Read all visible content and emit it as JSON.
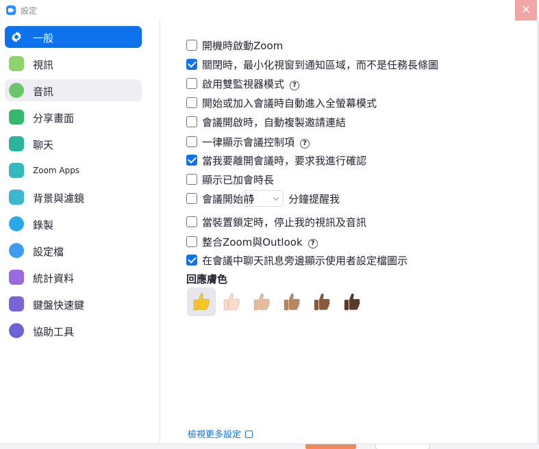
{
  "window": {
    "title": "設定",
    "close_symbol": "×"
  },
  "sidebar": {
    "items": [
      {
        "label": "一般",
        "icon": "gear-icon",
        "color": "#0e72ed",
        "state": "active"
      },
      {
        "label": "視訊",
        "icon": "video-camera-icon",
        "color": "#8fd36e"
      },
      {
        "label": "音訊",
        "icon": "headphones-icon",
        "color": "#6cc56a",
        "state": "hover"
      },
      {
        "label": "分享畫面",
        "icon": "share-screen-icon",
        "color": "#33b96c"
      },
      {
        "label": "聊天",
        "icon": "chat-bubble-icon",
        "color": "#2bb59a"
      },
      {
        "label": "Zoom Apps",
        "icon": "apps-icon",
        "color": "#35b9c0"
      },
      {
        "label": "背景與濾鏡",
        "icon": "background-icon",
        "color": "#3fb6cf"
      },
      {
        "label": "錄製",
        "icon": "record-icon",
        "color": "#29a9e8"
      },
      {
        "label": "設定檔",
        "icon": "profile-icon",
        "color": "#3f9bf0"
      },
      {
        "label": "統計資料",
        "icon": "statistics-icon",
        "color": "#9a6be0"
      },
      {
        "label": "鍵盤快速鍵",
        "icon": "keyboard-icon",
        "color": "#7a64d8"
      },
      {
        "label": "協助工具",
        "icon": "accessibility-icon",
        "color": "#6b62d6"
      }
    ]
  },
  "general": {
    "options": [
      {
        "label": "開機時啟動Zoom",
        "checked": false
      },
      {
        "label": "關閉時，最小化視窗到通知區域，而不是任務長條圖",
        "checked": true
      },
      {
        "label": "啟用雙監視器模式",
        "checked": false,
        "help": true
      },
      {
        "label": "開始或加入會議時自動進入全螢幕模式",
        "checked": false
      },
      {
        "label": "會議開啟時，自動複製邀請連結",
        "checked": false
      },
      {
        "label": "一律顯示會議控制項",
        "checked": false,
        "help": true
      },
      {
        "label": "當我要離開會議時，要求我進行確認",
        "checked": true
      },
      {
        "label": "顯示已加會時長",
        "checked": false
      },
      {
        "label": "會議開始前",
        "checked": false,
        "select_value": "5",
        "suffix": "分鐘提醒我"
      },
      {
        "label": "當裝置鎖定時，停止我的視訊及音訊",
        "checked": false
      },
      {
        "label": "整合Zoom與Outlook",
        "checked": false,
        "help": true
      },
      {
        "label": "在會議中聊天訊息旁邊顯示使用者設定檔圖示",
        "checked": true
      }
    ],
    "help_symbol": "?",
    "reaction": {
      "title": "回應膚色",
      "tones": [
        {
          "name": "thumbs-up-default-icon",
          "color": "#f7c623",
          "selected": true
        },
        {
          "name": "thumbs-up-light-icon",
          "color": "#fbdcc8"
        },
        {
          "name": "thumbs-up-medium-light-icon",
          "color": "#e8bc9a"
        },
        {
          "name": "thumbs-up-medium-icon",
          "color": "#b9875f"
        },
        {
          "name": "thumbs-up-medium-dark-icon",
          "color": "#8a5a3c"
        },
        {
          "name": "thumbs-up-dark-icon",
          "color": "#5a3a2a"
        }
      ]
    },
    "more_settings_link": "檢視更多設定"
  }
}
